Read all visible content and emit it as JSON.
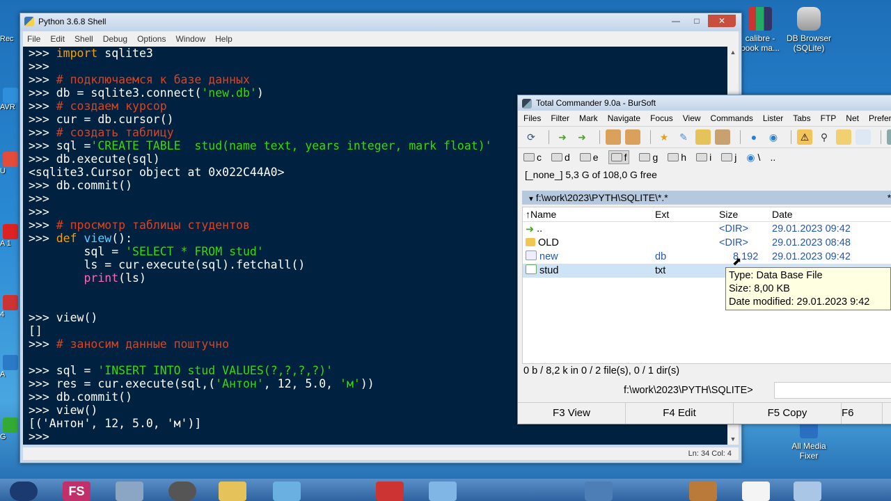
{
  "desktop": {
    "icons_right": [
      {
        "label": "calibre -\nbook ma..."
      },
      {
        "label": "DB Browser\n(SQLite)"
      },
      {
        "label": "All Media\nFixer"
      }
    ],
    "left_fragments": [
      "Rec",
      "AVR",
      "U",
      "A\n1",
      "4",
      "A",
      "G"
    ]
  },
  "python_shell": {
    "title": "Python 3.6.8 Shell",
    "menu": [
      "File",
      "Edit",
      "Shell",
      "Debug",
      "Options",
      "Window",
      "Help"
    ],
    "status": "Ln: 34   Col: 4",
    "lines": [
      [
        [
          "p",
          ">>> "
        ],
        [
          "kw",
          "import"
        ],
        [
          "p",
          " sqlite3"
        ]
      ],
      [
        [
          "p",
          ">>> "
        ]
      ],
      [
        [
          "p",
          ">>> "
        ],
        [
          "cm",
          "# подключаемся к базе данных"
        ]
      ],
      [
        [
          "p",
          ">>> db = sqlite3.connect("
        ],
        [
          "st",
          "'new.db'"
        ],
        [
          "p",
          ")"
        ]
      ],
      [
        [
          "p",
          ">>> "
        ],
        [
          "cm",
          "# создаем курсор"
        ]
      ],
      [
        [
          "p",
          ">>> cur = db.cursor()"
        ]
      ],
      [
        [
          "p",
          ">>> "
        ],
        [
          "cm",
          "# создать таблицу"
        ]
      ],
      [
        [
          "p",
          ">>> sql ="
        ],
        [
          "st",
          "'CREATE TABLE  stud(name text, years integer, mark float)'"
        ]
      ],
      [
        [
          "p",
          ">>> db.execute(sql)"
        ]
      ],
      [
        [
          "out",
          "<sqlite3.Cursor object at 0x022C44A0>"
        ]
      ],
      [
        [
          "p",
          ">>> db.commit()"
        ]
      ],
      [
        [
          "p",
          ">>> "
        ]
      ],
      [
        [
          "p",
          ">>> "
        ]
      ],
      [
        [
          "p",
          ">>> "
        ],
        [
          "cm",
          "# просмотр таблицы студентов"
        ]
      ],
      [
        [
          "p",
          ">>> "
        ],
        [
          "kw",
          "def"
        ],
        [
          "p",
          " "
        ],
        [
          "fn",
          "view"
        ],
        [
          "p",
          "():"
        ]
      ],
      [
        [
          "p",
          "        sql = "
        ],
        [
          "st",
          "'SELECT * FROM stud'"
        ]
      ],
      [
        [
          "p",
          "        ls = cur.execute(sql).fetchall()"
        ]
      ],
      [
        [
          "p",
          "        "
        ],
        [
          "bi",
          "print"
        ],
        [
          "p",
          "(ls)"
        ]
      ],
      [
        [
          "p",
          ""
        ]
      ],
      [
        [
          "p",
          ""
        ]
      ],
      [
        [
          "p",
          ">>> view()"
        ]
      ],
      [
        [
          "out",
          "[]"
        ]
      ],
      [
        [
          "p",
          ">>> "
        ],
        [
          "cm",
          "# заносим данные поштучно"
        ]
      ],
      [
        [
          "p",
          ""
        ]
      ],
      [
        [
          "p",
          ">>> sql = "
        ],
        [
          "st",
          "'INSERT INTO stud VALUES(?,?,?,?)'"
        ]
      ],
      [
        [
          "p",
          ">>> res = cur.execute(sql,("
        ],
        [
          "st",
          "'Антон'"
        ],
        [
          "p",
          ", 12, 5.0, "
        ],
        [
          "st",
          "'м'"
        ],
        [
          "p",
          "))"
        ]
      ],
      [
        [
          "p",
          ">>> db.commit()"
        ]
      ],
      [
        [
          "p",
          ">>> view()"
        ]
      ],
      [
        [
          "out",
          "[('Антон', 12, 5.0, 'м')]"
        ]
      ],
      [
        [
          "p",
          ">>> "
        ]
      ]
    ]
  },
  "total_commander": {
    "title": "Total Commander 9.0a - BurSoft",
    "menu": [
      "Files",
      "Filter",
      "Mark",
      "Navigate",
      "Focus",
      "View",
      "Commands",
      "Lister",
      "Tabs",
      "FTP",
      "Net",
      "Prefere"
    ],
    "drives": [
      "c",
      "d",
      "e",
      "f",
      "g",
      "h",
      "i",
      "j",
      "\\",
      ".."
    ],
    "active_drive": "f",
    "free_space": "[_none_]  5,3 G of 108,0 G free",
    "path": "f:\\work\\2023\\PYTH\\SQLITE\\*.*",
    "path_controls": "*  ▼",
    "columns": {
      "name": "↑Name",
      "ext": "Ext",
      "size": "Size",
      "date": "Date"
    },
    "files": [
      {
        "name": "..",
        "ext": "",
        "size": "<DIR>",
        "date": "29.01.2023 09:42"
      },
      {
        "name": "OLD",
        "ext": "",
        "size": "<DIR>",
        "date": "29.01.2023 08:48"
      },
      {
        "name": "new",
        "ext": "db",
        "size": "8 192",
        "date": "29.01.2023 09:42"
      },
      {
        "name": "stud",
        "ext": "txt",
        "size": "",
        "date": ""
      }
    ],
    "info": "0 b / 8,2 k in 0 / 2 file(s), 0 / 1 dir(s)",
    "cmd_path": "f:\\work\\2023\\PYTH\\SQLITE>",
    "fkeys": [
      "F3 View",
      "F4 Edit",
      "F5 Copy",
      "F6"
    ]
  },
  "tooltip": {
    "type": "Type: Data Base File",
    "size": "Size: 8,00 KB",
    "date": "Date modified: 29.01.2023 9:42"
  },
  "taskbar": {
    "fs_label": "FS"
  }
}
